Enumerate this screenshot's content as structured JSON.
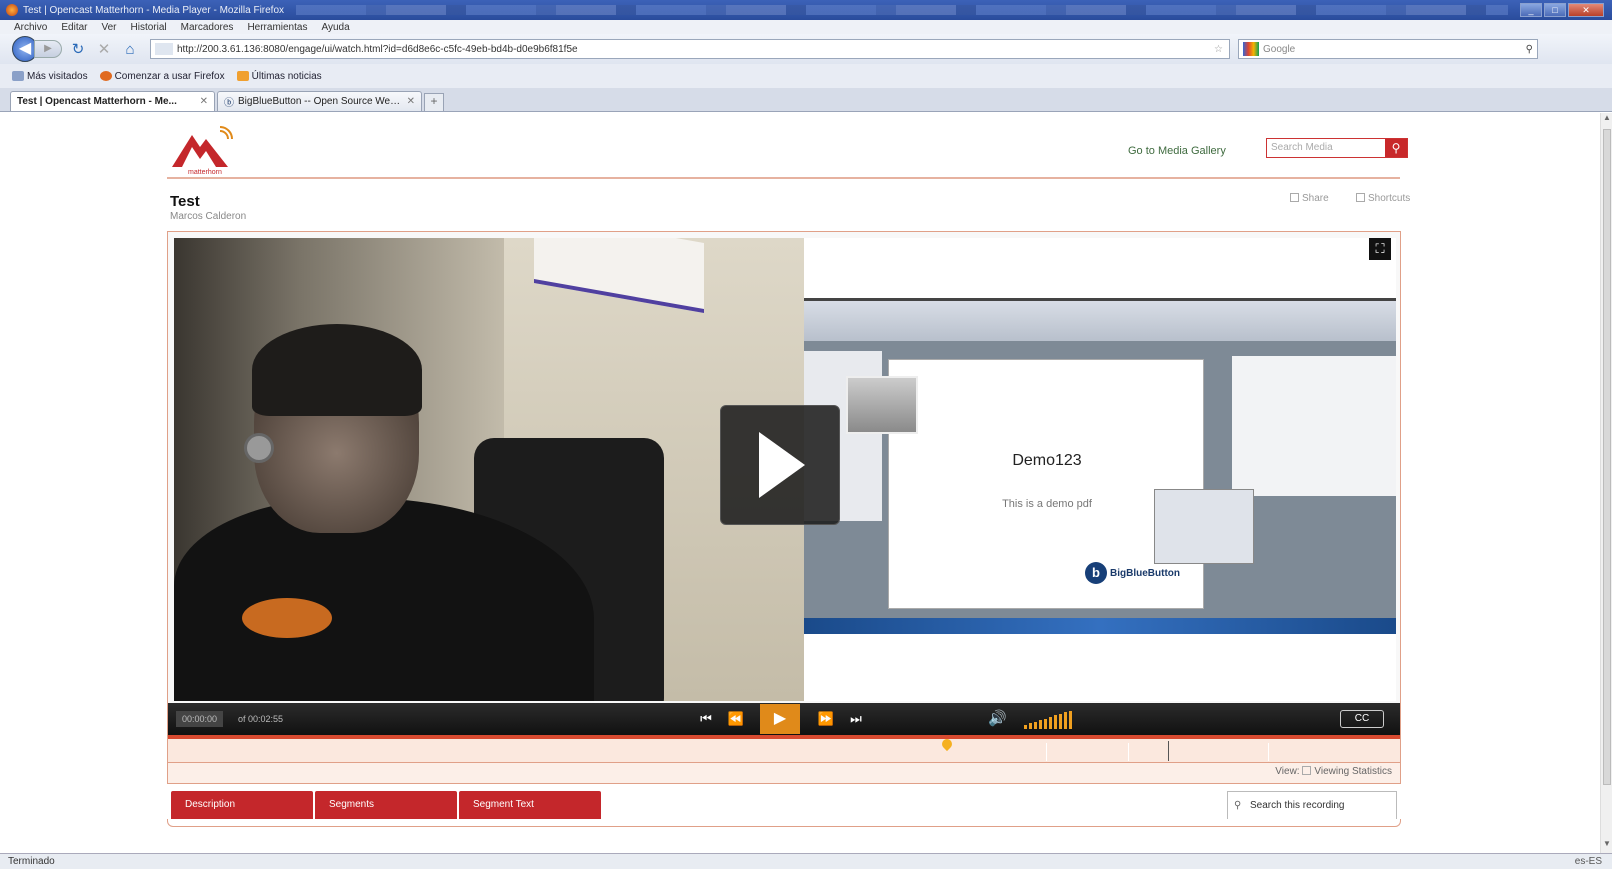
{
  "browser": {
    "window_title": "Test | Opencast Matterhorn - Media Player - Mozilla Firefox",
    "menu": [
      "Archivo",
      "Editar",
      "Ver",
      "Historial",
      "Marcadores",
      "Herramientas",
      "Ayuda"
    ],
    "url": "http://200.3.61.136:8080/engage/ui/watch.html?id=d6d8e6c-c5fc-49eb-bd4b-d0e9b6f81f5e",
    "search_placeholder": "Google",
    "bookmarks": [
      "Más visitados",
      "Comenzar a usar Firefox",
      "Últimas noticias"
    ],
    "tabs": [
      {
        "label": "Test | Opencast Matterhorn - Me...",
        "active": true
      },
      {
        "label": "BigBlueButton -- Open Source Web...",
        "active": false
      }
    ],
    "status_left": "Terminado",
    "status_right": "es-ES"
  },
  "page": {
    "logo_text": "matterhorn",
    "gallery_link": "Go to Media Gallery",
    "search_media_placeholder": "Search Media",
    "title": "Test",
    "author": "Marcos Calderon",
    "share": "Share",
    "shortcuts": "Shortcuts"
  },
  "player": {
    "slide_title": "Demo123",
    "slide_subtitle": "This is a demo pdf",
    "slide_brand": "BigBlueButton",
    "current_time": "00:00:00",
    "total_time": "of 00:02:55",
    "volume_level": 1.0,
    "cc_label": "CC",
    "view_label": "View:",
    "viewing_statistics": "Viewing Statistics"
  },
  "tabs": [
    "Description",
    "Segments",
    "Segment Text"
  ],
  "search_recording": "Search this recording",
  "colors": {
    "accent_red": "#c4272b",
    "accent_orange": "#e08a1a",
    "border_salmon": "#e0a088"
  }
}
